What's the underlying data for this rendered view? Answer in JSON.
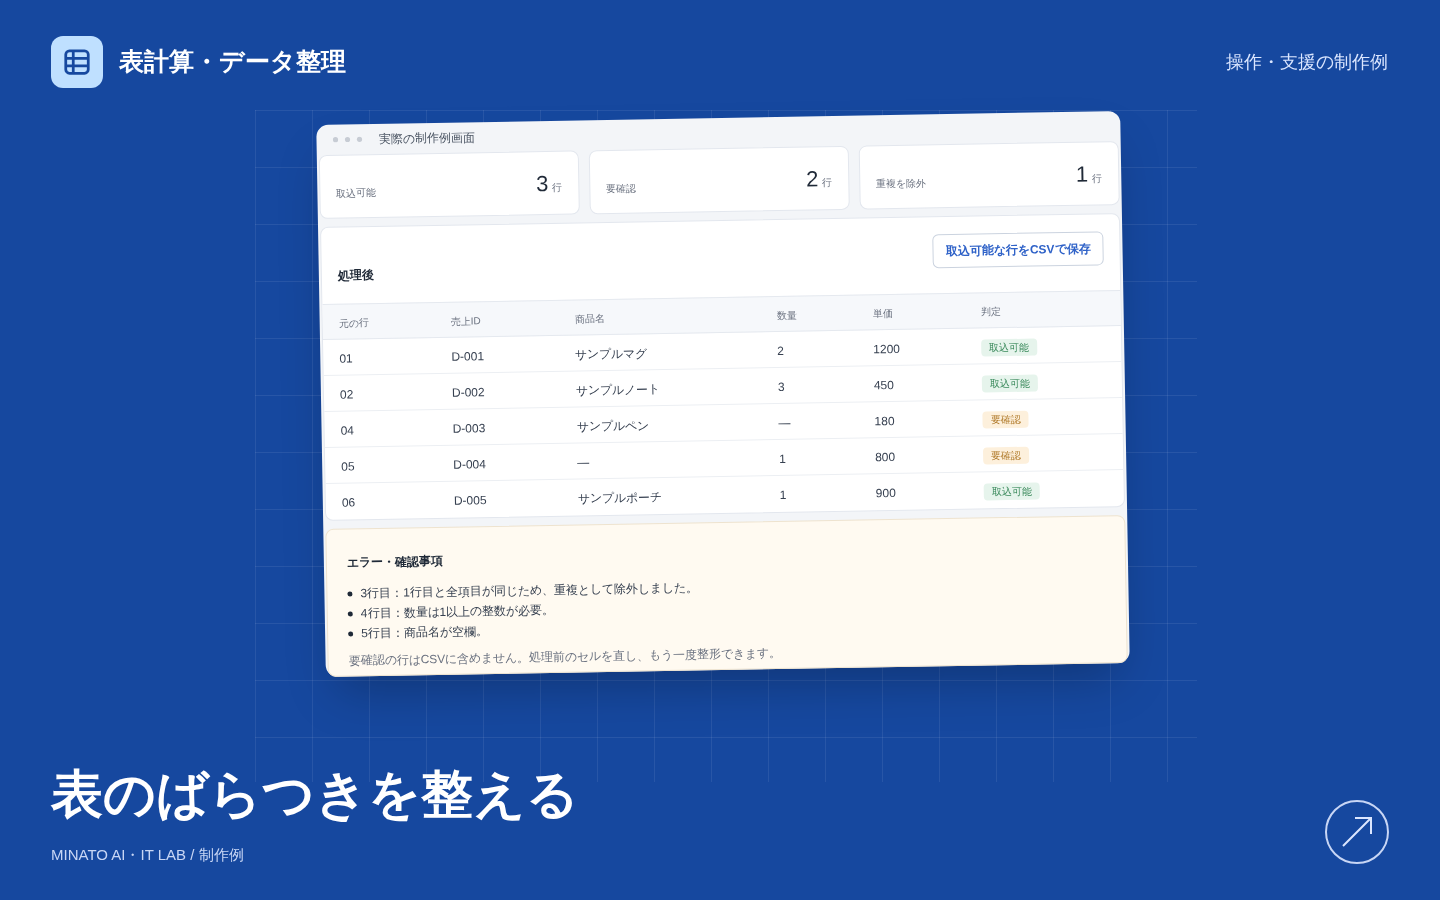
{
  "header": {
    "title": "表計算・データ整理",
    "tagline": "操作・支援の制作例"
  },
  "window": {
    "title": "実際の制作例画面",
    "stats": [
      {
        "label": "取込可能",
        "value": "3",
        "unit": "行"
      },
      {
        "label": "要確認",
        "value": "2",
        "unit": "行"
      },
      {
        "label": "重複を除外",
        "value": "1",
        "unit": "行"
      }
    ],
    "table_card": {
      "title": "処理後",
      "button": "取込可能な行をCSVで保存",
      "columns": [
        "元の行",
        "売上ID",
        "商品名",
        "数量",
        "単価",
        "判定"
      ],
      "rows": [
        {
          "cells": [
            "01",
            "D-001",
            "サンプルマグ",
            "2",
            "1200"
          ],
          "status": {
            "label": "取込可能",
            "kind": "ok"
          }
        },
        {
          "cells": [
            "02",
            "D-002",
            "サンプルノート",
            "3",
            "450"
          ],
          "status": {
            "label": "取込可能",
            "kind": "ok"
          }
        },
        {
          "cells": [
            "04",
            "D-003",
            "サンプルペン",
            "—",
            "180"
          ],
          "status": {
            "label": "要確認",
            "kind": "warn"
          }
        },
        {
          "cells": [
            "05",
            "D-004",
            "—",
            "1",
            "800"
          ],
          "status": {
            "label": "要確認",
            "kind": "warn"
          }
        },
        {
          "cells": [
            "06",
            "D-005",
            "サンプルポーチ",
            "1",
            "900"
          ],
          "status": {
            "label": "取込可能",
            "kind": "ok"
          }
        }
      ]
    },
    "errors": {
      "title": "エラー・確認事項",
      "items": [
        "3行目：1行目と全項目が同じため、重複として除外しました。",
        "4行目：数量は1以上の整数が必要。",
        "5行目：商品名が空欄。"
      ],
      "note": "要確認の行はCSVに含めません。処理前のセルを直し、もう一度整形できます。"
    }
  },
  "headline": "表のばらつきを整える",
  "credit": "MINATO AI・IT LAB / 制作例"
}
